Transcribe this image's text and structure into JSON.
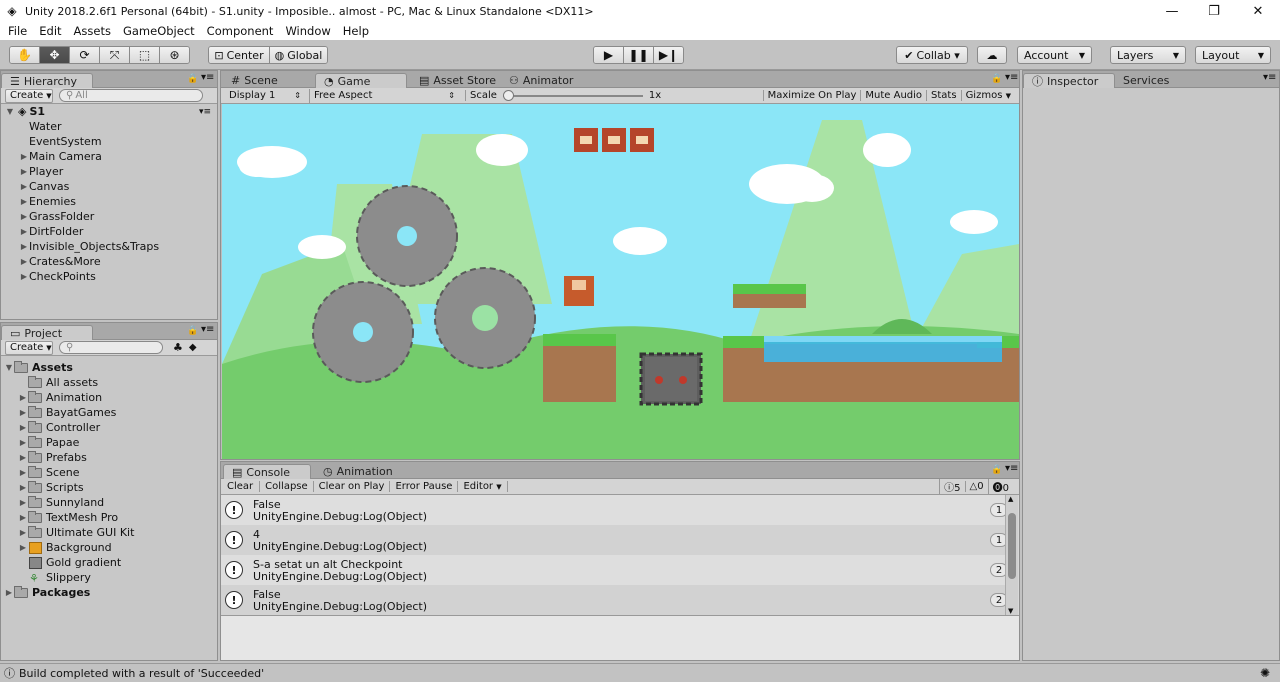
{
  "window": {
    "title": "Unity 2018.2.6f1 Personal (64bit) - S1.unity - Imposible.. almost - PC, Mac & Linux Standalone <DX11>"
  },
  "menu": [
    "File",
    "Edit",
    "Assets",
    "GameObject",
    "Component",
    "Window",
    "Help"
  ],
  "toolbar": {
    "center": "Center",
    "global": "Global",
    "collab": "Collab ▾",
    "account": "Account",
    "layers": "Layers",
    "layout": "Layout"
  },
  "hierarchy": {
    "tab": "Hierarchy",
    "create": "Create",
    "search_placeholder": "All",
    "scene": "S1",
    "items": [
      {
        "label": "Water",
        "arrow": false
      },
      {
        "label": "EventSystem",
        "arrow": false
      },
      {
        "label": "Main Camera",
        "arrow": true
      },
      {
        "label": "Player",
        "arrow": true
      },
      {
        "label": "Canvas",
        "arrow": true
      },
      {
        "label": "Enemies",
        "arrow": true
      },
      {
        "label": "GrassFolder",
        "arrow": true
      },
      {
        "label": "DirtFolder",
        "arrow": true
      },
      {
        "label": "Invisible_Objects&Traps",
        "arrow": true
      },
      {
        "label": "Crates&More",
        "arrow": true
      },
      {
        "label": "CheckPoints",
        "arrow": true
      }
    ]
  },
  "project": {
    "tab": "Project",
    "create": "Create",
    "root": "Assets",
    "items": [
      "All assets",
      "Animation",
      "BayatGames",
      "Controller",
      "Papae",
      "Prefabs",
      "Scene",
      "Scripts",
      "Sunnyland",
      "TextMesh Pro",
      "Ultimate GUI Kit",
      "Background",
      "Gold gradient",
      "Slippery"
    ],
    "packages": "Packages"
  },
  "view_tabs": {
    "scene": "Scene",
    "game": "Game",
    "asset_store": "Asset Store",
    "animator": "Animator"
  },
  "game_bar": {
    "display": "Display 1",
    "aspect": "Free Aspect",
    "scale_label": "Scale",
    "scale_value": "1x",
    "maximize": "Maximize On Play",
    "mute": "Mute Audio",
    "stats": "Stats",
    "gizmos": "Gizmos"
  },
  "console": {
    "tab": "Console",
    "tab2": "Animation",
    "buttons": [
      "Clear",
      "Collapse",
      "Clear on Play",
      "Error Pause",
      "Editor"
    ],
    "counts": {
      "info": "5",
      "warn": "0",
      "error": "0"
    },
    "entries": [
      {
        "line1": "False",
        "line2": "UnityEngine.Debug:Log(Object)",
        "count": "1"
      },
      {
        "line1": "4",
        "line2": "UnityEngine.Debug:Log(Object)",
        "count": "1"
      },
      {
        "line1": "S-a setat un alt Checkpoint",
        "line2": "UnityEngine.Debug:Log(Object)",
        "count": "2"
      },
      {
        "line1": "False",
        "line2": "UnityEngine.Debug:Log(Object)",
        "count": "2"
      }
    ]
  },
  "inspector": {
    "tab": "Inspector",
    "services": "Services"
  },
  "status": {
    "message": "Build completed with a result of 'Succeeded'"
  }
}
